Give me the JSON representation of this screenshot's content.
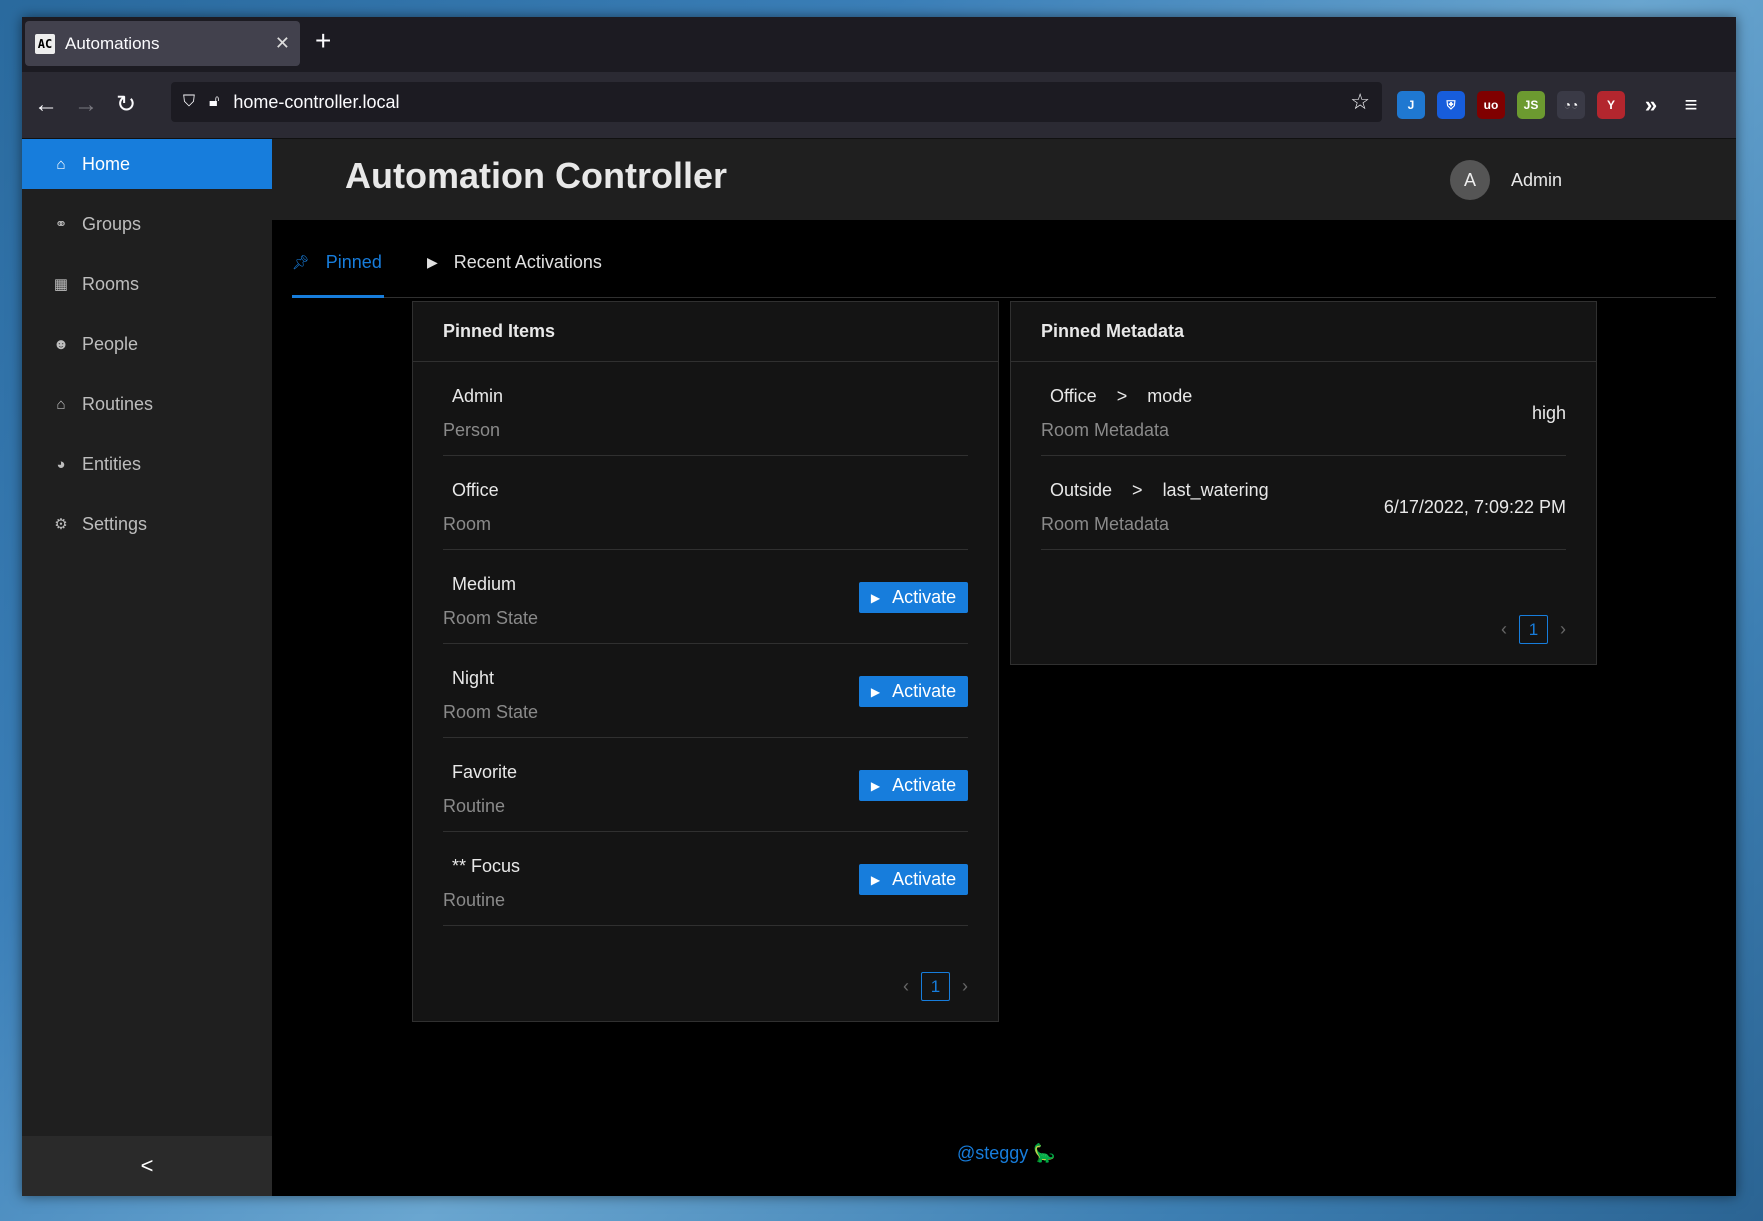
{
  "browser": {
    "tab_title": "Automations",
    "favicon_text": "AC",
    "url": "home-controller.local"
  },
  "sidebar": {
    "items": [
      {
        "label": "Home",
        "icon": "home-icon"
      },
      {
        "label": "Groups",
        "icon": "groups-icon"
      },
      {
        "label": "Rooms",
        "icon": "rooms-icon"
      },
      {
        "label": "People",
        "icon": "people-icon"
      },
      {
        "label": "Routines",
        "icon": "routines-icon"
      },
      {
        "label": "Entities",
        "icon": "entities-icon"
      },
      {
        "label": "Settings",
        "icon": "gear-icon"
      }
    ],
    "collapse": "<"
  },
  "header": {
    "title": "Automation Controller",
    "avatar_letter": "A",
    "user": "Admin"
  },
  "tabs": [
    {
      "label": "Pinned"
    },
    {
      "label": "Recent Activations"
    }
  ],
  "pinned_items": {
    "title": "Pinned Items",
    "rows": [
      {
        "title": "Admin",
        "sub": "Person"
      },
      {
        "title": "Office",
        "sub": "Room"
      },
      {
        "title": "Medium",
        "sub": "Room State",
        "action": "Activate"
      },
      {
        "title": "Night",
        "sub": "Room State",
        "action": "Activate"
      },
      {
        "title": "Favorite",
        "sub": "Routine",
        "action": "Activate"
      },
      {
        "title": "** Focus",
        "sub": "Routine",
        "action": "Activate"
      }
    ],
    "page": "1"
  },
  "pinned_metadata": {
    "title": "Pinned Metadata",
    "rows": [
      {
        "left": "Office",
        "sep": ">",
        "right": "mode",
        "sub": "Room Metadata",
        "value": "high"
      },
      {
        "left": "Outside",
        "sep": ">",
        "right": "last_watering",
        "sub": "Room Metadata",
        "value": "6/17/2022, 7:09:22 PM"
      }
    ],
    "page": "1"
  },
  "footer": "@steggy 🦕",
  "colors": {
    "accent": "#177ddc",
    "sidebar": "#1f1f1f",
    "background": "#000000"
  }
}
